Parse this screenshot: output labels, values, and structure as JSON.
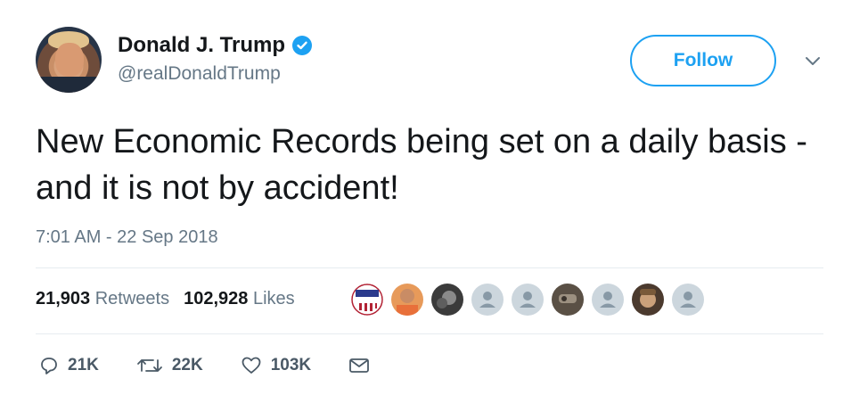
{
  "author": {
    "display_name": "Donald J. Trump",
    "handle": "@realDonaldTrump",
    "verified_icon": "verified-badge-icon"
  },
  "follow_button": {
    "label": "Follow"
  },
  "tweet": {
    "text": "New Economic Records being set on a daily basis - and it is not by accident!",
    "timestamp": "7:01 AM - 22 Sep 2018"
  },
  "stats": {
    "retweets_count": "21,903",
    "retweets_label": "Retweets",
    "likes_count": "102,928",
    "likes_label": "Likes"
  },
  "actions": {
    "reply_count": "21K",
    "retweet_count": "22K",
    "like_count": "103K"
  },
  "colors": {
    "accent": "#1da1f2",
    "secondary_text": "#657786",
    "divider": "#e6ecf0"
  }
}
